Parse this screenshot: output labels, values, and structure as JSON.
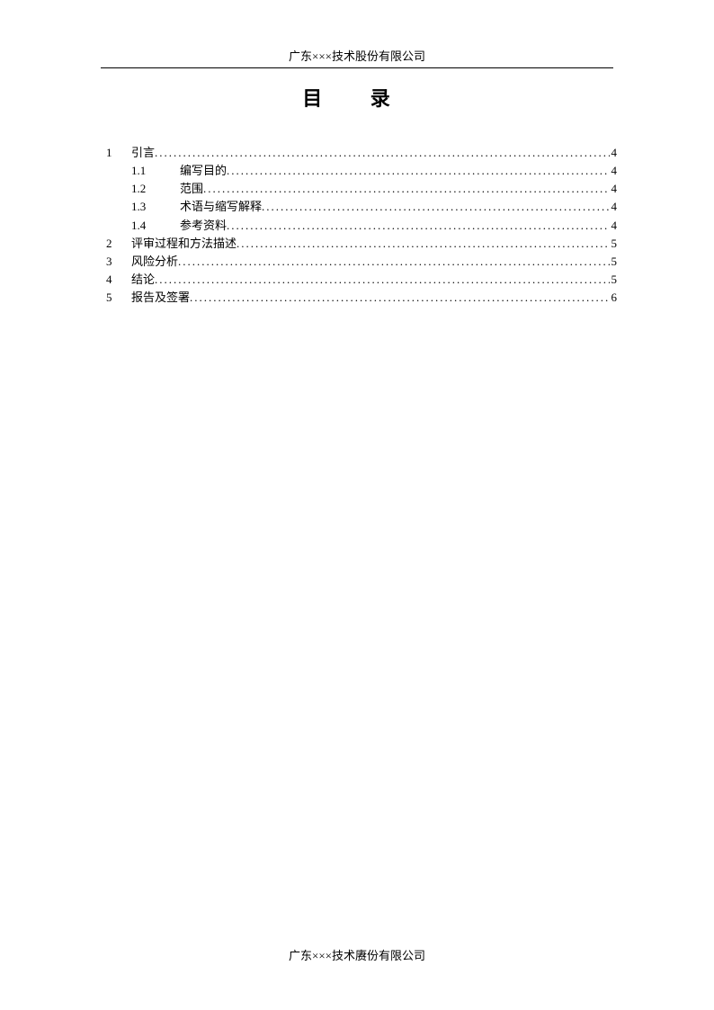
{
  "header": {
    "text": "广东×××技术股份有限公司"
  },
  "title": "目 录",
  "toc": [
    {
      "num": "1",
      "label": "引言",
      "page": "4",
      "level": 1
    },
    {
      "num": "1.1",
      "label": "编写目的",
      "page": "4",
      "level": 2
    },
    {
      "num": "1.2",
      "label": "范围",
      "page": "4",
      "level": 2
    },
    {
      "num": "1.3",
      "label": "术语与缩写解释",
      "page": "4",
      "level": 2
    },
    {
      "num": "1.4",
      "label": "参考资料",
      "page": "4",
      "level": 2
    },
    {
      "num": "2",
      "label": "评审过程和方法描述",
      "page": "5",
      "level": 1
    },
    {
      "num": "3",
      "label": "风险分析",
      "page": "5",
      "level": 1
    },
    {
      "num": "4",
      "label": "结论",
      "page": "5",
      "level": 1
    },
    {
      "num": "5",
      "label": "报告及签署",
      "page": "6",
      "level": 1
    }
  ],
  "footer": {
    "text": "广东×××技术赓份有限公司"
  }
}
